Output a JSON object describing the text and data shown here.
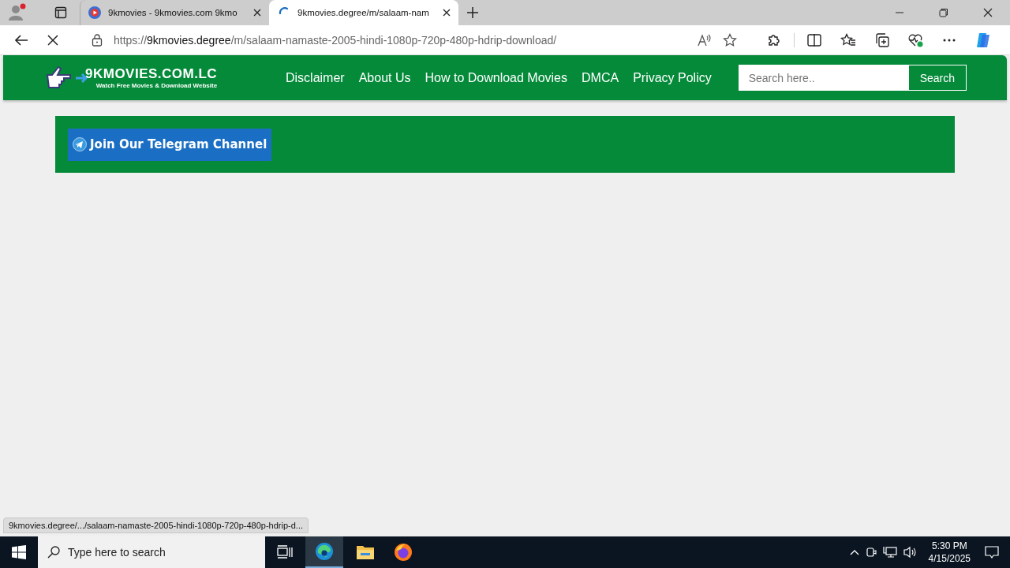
{
  "browser": {
    "tabs": [
      {
        "title": "9kmovies - 9kmovies.com 9kmo",
        "selected": false,
        "kind": "video"
      },
      {
        "title": "9kmovies.degree/m/salaam-nam",
        "selected": true,
        "kind": "loading"
      }
    ],
    "url": {
      "scheme": "https://",
      "host": "9kmovies.degree",
      "path": "/m/salaam-namaste-2005-hindi-1080p-720p-480p-hdrip-download/"
    },
    "status_url": "9kmovies.degree/.../salaam-namaste-2005-hindi-1080p-720p-480p-hdrip-d..."
  },
  "site": {
    "logo": "9KMOVIES.COM.LC",
    "tagline": "Watch Free Movies & Download Website",
    "nav": [
      "Disclaimer",
      "About Us",
      "How to Download Movies",
      "DMCA",
      "Privacy Policy"
    ],
    "search": {
      "placeholder": "Search here..",
      "button": "Search"
    },
    "telegram_button": "Join Our Telegram Channel"
  },
  "taskbar": {
    "search_placeholder": "Type here to search",
    "time": "5:30 PM",
    "date": "4/15/2025"
  }
}
